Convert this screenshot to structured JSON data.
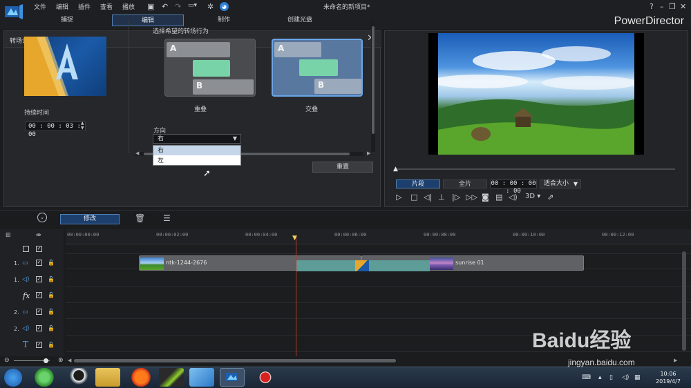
{
  "window": {
    "title": "未命名的新项目*",
    "brand": "PowerDirector"
  },
  "menu": [
    "文件",
    "编辑",
    "插件",
    "查看",
    "播放"
  ],
  "tabs": [
    {
      "label": "捕捉",
      "active": false
    },
    {
      "label": "编辑",
      "active": true
    },
    {
      "label": "制作",
      "active": false
    },
    {
      "label": "创建光盘",
      "active": false
    }
  ],
  "panel": {
    "title": "转场设置",
    "duration_label": "持续时间",
    "duration_value": "00 : 00 : 03 : 00",
    "choose_label": "选择希望的转场行为",
    "modes": [
      {
        "label": "重叠",
        "selected": false
      },
      {
        "label": "交叠",
        "selected": true
      }
    ],
    "block_a": "A",
    "block_b": "B",
    "direction_label": "方向",
    "direction_value": "右",
    "direction_options": [
      "右",
      "左"
    ],
    "reset_label": "重置"
  },
  "preview": {
    "tabs": [
      {
        "label": "片段",
        "active": true
      },
      {
        "label": "全片",
        "active": false
      }
    ],
    "timecode": "00 : 00 : 00 : 00",
    "fit_label": "适合大小",
    "mode_3d": "3D"
  },
  "toolbar": {
    "modify_label": "修改"
  },
  "timeline": {
    "ruler": [
      "00:00:00:00",
      "00:00:02:00",
      "00:00:04:00",
      "00:00:06:00",
      "00:00:08:00",
      "00:00:10:00",
      "00:00:12:00"
    ],
    "tracks": [
      "1.",
      "1.",
      "",
      "2.",
      "2.",
      ""
    ],
    "clips": [
      {
        "label": "ntk-1244-2676"
      },
      {
        "label": "sunrise 01"
      }
    ]
  },
  "taskbar": {
    "time": "10:06",
    "date": "2019/4/7"
  },
  "watermark": {
    "main": "Baidu经验",
    "sub": "jingyan.baidu.com"
  },
  "colors": {
    "accent": "#4f7fb5",
    "active_bg": "#1d3f6e",
    "playhead": "#b33b2f",
    "transition": "#5e9c98"
  }
}
